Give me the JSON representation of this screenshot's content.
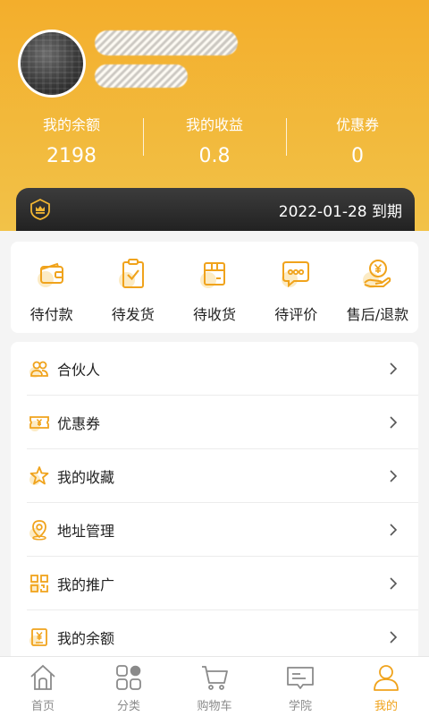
{
  "colors": {
    "accent": "#f0a31c",
    "header_top": "#f3ae2c",
    "header_bottom": "#f2c248",
    "vip_bar": "#2a2a2a",
    "tab_inactive": "#8a8a8a"
  },
  "profile": {
    "avatar_icon": "keyboard-photo-avatar",
    "name_redacted": true
  },
  "stats": [
    {
      "label": "我的余额",
      "value": "2198"
    },
    {
      "label": "我的收益",
      "value": "0.8"
    },
    {
      "label": "优惠券",
      "value": "0"
    }
  ],
  "vip": {
    "icon": "crown-badge-icon",
    "expire_text": "2022-01-28 到期"
  },
  "orders": [
    {
      "label": "待付款",
      "icon": "wallet-icon"
    },
    {
      "label": "待发货",
      "icon": "clipboard-check-icon"
    },
    {
      "label": "待收货",
      "icon": "package-box-icon"
    },
    {
      "label": "待评价",
      "icon": "chat-bubble-icon"
    },
    {
      "label": "售后/退款",
      "icon": "yen-hand-icon"
    }
  ],
  "menu": [
    {
      "label": "合伙人",
      "icon": "partner-people-icon"
    },
    {
      "label": "优惠券",
      "icon": "coupon-ticket-icon"
    },
    {
      "label": "我的收藏",
      "icon": "star-favorite-icon"
    },
    {
      "label": "地址管理",
      "icon": "location-pin-icon"
    },
    {
      "label": "我的推广",
      "icon": "qr-code-icon"
    },
    {
      "label": "我的余额",
      "icon": "yen-document-icon"
    }
  ],
  "tabs": [
    {
      "label": "首页",
      "icon": "home-icon",
      "active": false
    },
    {
      "label": "分类",
      "icon": "category-grid-icon",
      "active": false
    },
    {
      "label": "购物车",
      "icon": "shopping-cart-icon",
      "active": false
    },
    {
      "label": "学院",
      "icon": "book-icon",
      "active": false
    },
    {
      "label": "我的",
      "icon": "user-profile-icon",
      "active": true
    }
  ]
}
